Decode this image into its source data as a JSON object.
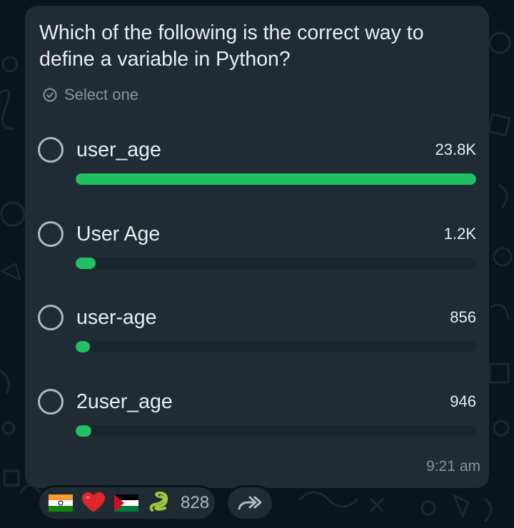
{
  "poll": {
    "question": "Which of the following is the correct way to define a variable in Python?",
    "select_hint": "Select one",
    "options": [
      {
        "label": "user_age",
        "count": "23.8K",
        "fraction": 1.0
      },
      {
        "label": "User Age",
        "count": "1.2K",
        "fraction": 0.05
      },
      {
        "label": "user-age",
        "count": "856",
        "fraction": 0.036
      },
      {
        "label": "2user_age",
        "count": "946",
        "fraction": 0.04
      }
    ],
    "time": "9:21 am"
  },
  "reactions": {
    "items": [
      {
        "name": "india-flag-icon"
      },
      {
        "name": "red-heart-icon"
      },
      {
        "name": "palestine-flag-icon"
      },
      {
        "name": "snake-icon"
      }
    ],
    "count": "828"
  },
  "colors": {
    "bubble": "#1f2c34",
    "background": "#0b141a",
    "fill": "#21c063",
    "track": "#18252c",
    "text": "#e9edef",
    "muted": "#8696a0"
  }
}
